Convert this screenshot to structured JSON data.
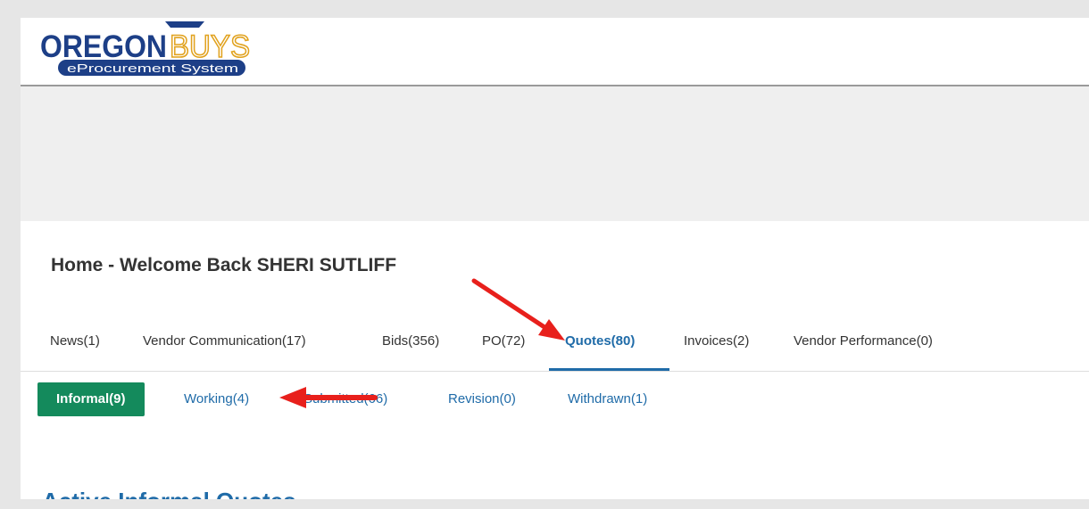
{
  "header": {
    "logo": {
      "name_part1": "OREGON",
      "name_part2": "BUYS",
      "tagline": "eProcurement System"
    }
  },
  "page": {
    "title": "Home - Welcome Back SHERI SUTLIFF"
  },
  "main_tabs": [
    {
      "label": "News(1)",
      "active": false
    },
    {
      "label": "Vendor Communication(17)",
      "active": false
    },
    {
      "label": "Bids(356)",
      "active": false
    },
    {
      "label": "PO(72)",
      "active": false
    },
    {
      "label": "Quotes(80)",
      "active": true
    },
    {
      "label": "Invoices(2)",
      "active": false
    },
    {
      "label": "Vendor Performance(0)",
      "active": false
    }
  ],
  "sub_tabs": [
    {
      "label": "Informal(9)",
      "active": true
    },
    {
      "label": "Working(4)",
      "active": false
    },
    {
      "label": "Submitted(66)",
      "active": false
    },
    {
      "label": "Revision(0)",
      "active": false
    },
    {
      "label": "Withdrawn(1)",
      "active": false
    }
  ],
  "section": {
    "title": "Active Informal Quotes"
  },
  "annotation": {
    "arrow_color": "#e8201c",
    "icons": [
      "arrow-pointing-quotes-tab",
      "arrow-pointing-working-tab"
    ]
  },
  "colors": {
    "link_blue": "#1f6ba8",
    "active_green": "#148a5c",
    "banner_gray": "#efefef",
    "logo_navy": "#1d3f87",
    "logo_gold": "#e1a21e"
  }
}
